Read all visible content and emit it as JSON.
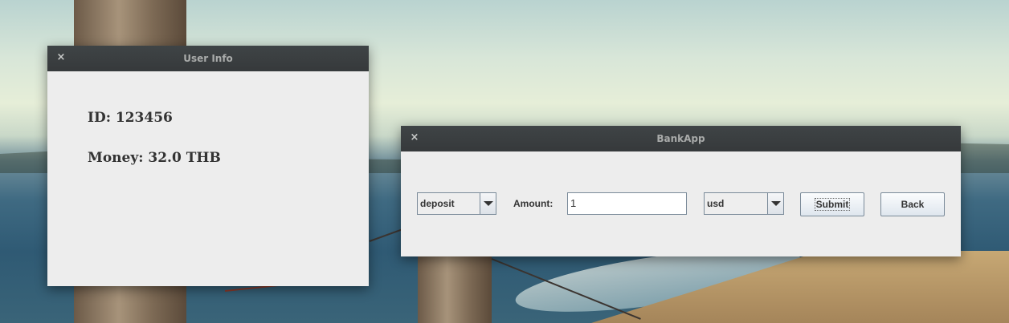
{
  "windows": {
    "user_info": {
      "title": "User Info",
      "close_glyph": "×",
      "id_line": "ID: 123456",
      "money_line": "Money: 32.0 THB"
    },
    "bankapp": {
      "title": "BankApp",
      "close_glyph": "×",
      "transaction_type": {
        "selected": "deposit"
      },
      "amount_label": "Amount:",
      "amount_value": "1",
      "currency": {
        "selected": "usd"
      },
      "submit_label": "Submit",
      "back_label": "Back"
    }
  },
  "icons": {
    "close": "close-icon",
    "dropdown": "chevron-down-icon"
  },
  "colors": {
    "titlebar": "#3a3e40",
    "titlebar_text": "#a9abaa",
    "window_bg": "#ededed"
  }
}
